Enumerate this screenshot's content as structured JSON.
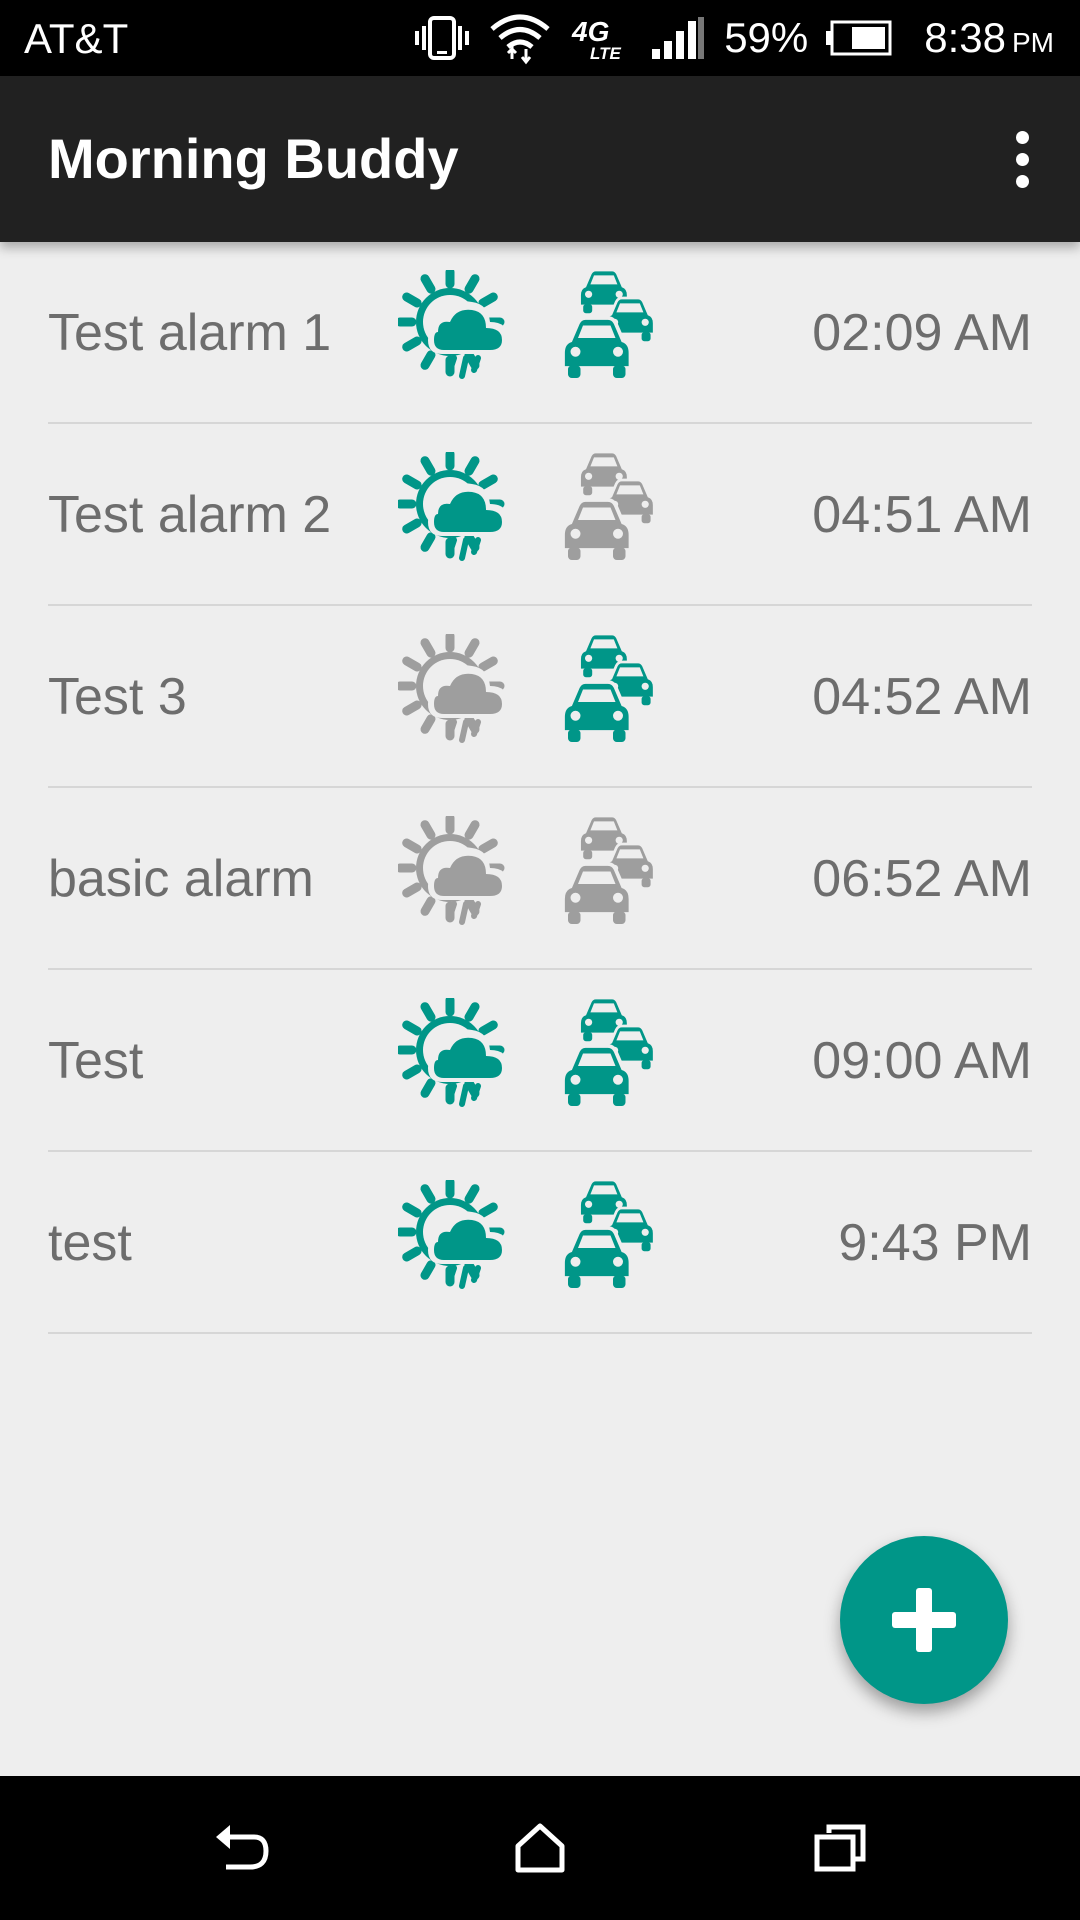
{
  "status_bar": {
    "carrier": "AT&T",
    "network": "4G LTE",
    "battery_percent": "59%",
    "time": "8:38",
    "ampm": "PM",
    "icons": [
      "vibrate-icon",
      "wifi-icon",
      "lte-icon",
      "signal-icon",
      "battery-icon"
    ]
  },
  "app_bar": {
    "title": "Morning Buddy",
    "menu_icon": "more-vert-icon"
  },
  "colors": {
    "active": "#009688",
    "inactive": "#9e9e9e"
  },
  "alarms": [
    {
      "name": "Test alarm 1",
      "time": "02:09 AM",
      "weather_enabled": true,
      "traffic_enabled": true
    },
    {
      "name": "Test alarm 2",
      "time": "04:51 AM",
      "weather_enabled": true,
      "traffic_enabled": false
    },
    {
      "name": "Test 3",
      "time": "04:52 AM",
      "weather_enabled": false,
      "traffic_enabled": true
    },
    {
      "name": "basic alarm",
      "time": "06:52 AM",
      "weather_enabled": false,
      "traffic_enabled": false
    },
    {
      "name": "Test",
      "time": "09:00 AM",
      "weather_enabled": true,
      "traffic_enabled": true
    },
    {
      "name": "test",
      "time": "9:43 PM",
      "weather_enabled": true,
      "traffic_enabled": true
    }
  ],
  "fab": {
    "icon": "add-icon"
  },
  "nav_bar": {
    "icons": [
      "back-icon",
      "home-icon",
      "recents-icon"
    ]
  }
}
